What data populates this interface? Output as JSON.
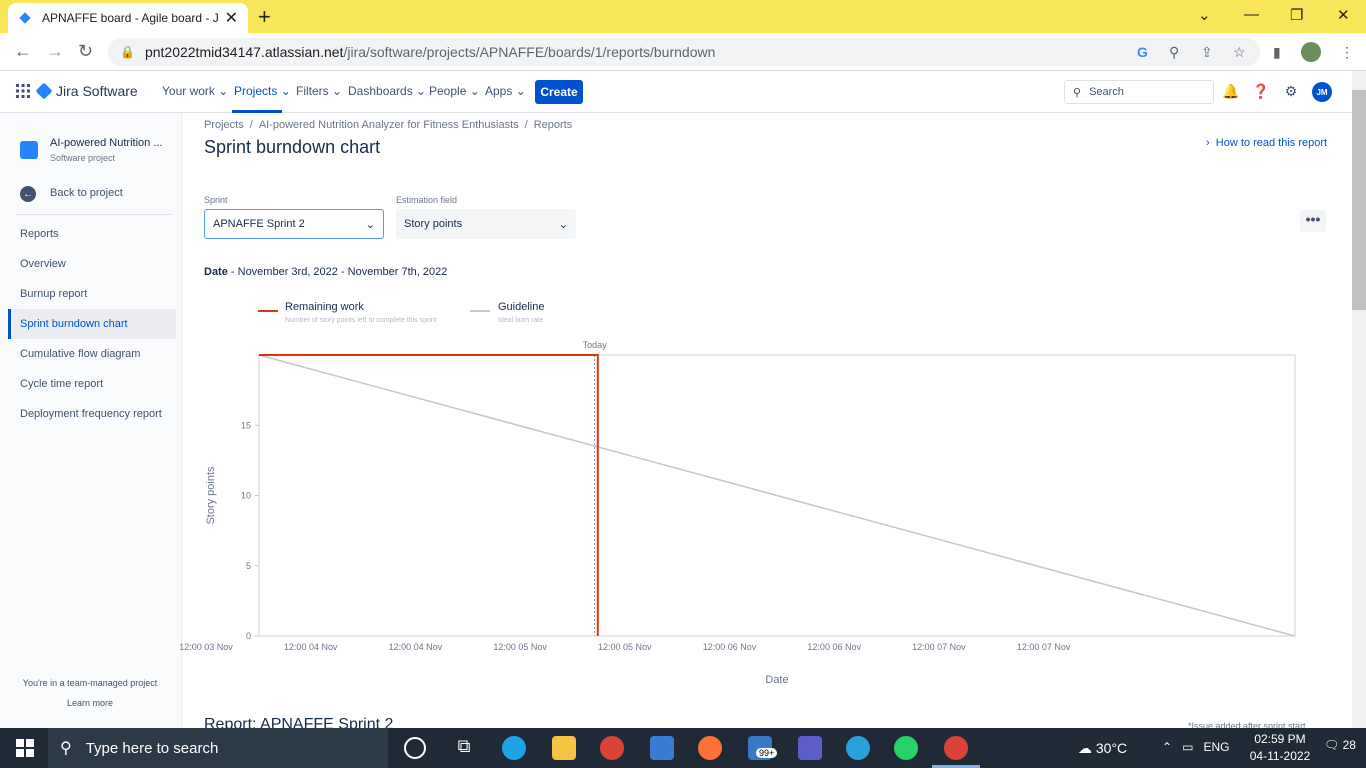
{
  "browser": {
    "tab_title": "APNAFFE board - Agile board - Ji",
    "url_domain": "pnt2022tmid34147.atlassian.net",
    "url_path": "/jira/software/projects/APNAFFE/boards/1/reports/burndown"
  },
  "nav": {
    "brand": "Jira Software",
    "items": [
      "Your work",
      "Projects",
      "Filters",
      "Dashboards",
      "People",
      "Apps"
    ],
    "create": "Create",
    "search_placeholder": "Search",
    "avatar": "JM"
  },
  "sidebar": {
    "project_name": "AI-powered Nutrition ...",
    "project_type": "Software project",
    "back": "Back to project",
    "heading": "Reports",
    "items": [
      "Overview",
      "Burnup report",
      "Sprint burndown chart",
      "Cumulative flow diagram",
      "Cycle time report",
      "Deployment frequency report"
    ],
    "selected": "Sprint burndown chart",
    "team_note": "You're in a team-managed project",
    "learn_more": "Learn more"
  },
  "main": {
    "breadcrumb": [
      "Projects",
      "AI-powered Nutrition Analyzer for Fitness Enthusiasts",
      "Reports"
    ],
    "title": "Sprint burndown chart",
    "how_to": "How to read this report",
    "sprint_label": "Sprint",
    "sprint_value": "APNAFFE Sprint 2",
    "estimation_label": "Estimation field",
    "estimation_value": "Story points",
    "date_label": "Date",
    "date_value": " - November 3rd, 2022 - November 7th, 2022",
    "next_heading": "Report: APNAFFE Sprint 2",
    "issue_note": "*Issue added after sprint start"
  },
  "legend": [
    {
      "name": "Remaining work",
      "desc": "Number of story points left to complete this sprint",
      "color": "#de350b"
    },
    {
      "name": "Guideline",
      "desc": "Ideal burn rate",
      "color": "#c1c7d0"
    }
  ],
  "chart_data": {
    "type": "line",
    "xlabel": "Date",
    "ylabel": "Story points",
    "today_label": "Today",
    "x_ticks": [
      "12:00 03 Nov",
      "12:00 04 Nov",
      "12:00 04 Nov",
      "12:00 05 Nov",
      "12:00 05 Nov",
      "12:00 06 Nov",
      "12:00 06 Nov",
      "12:00 07 Nov",
      "12:00 07 Nov"
    ],
    "y_ticks": [
      0,
      5,
      10,
      15
    ],
    "ylim": [
      0,
      20
    ],
    "series": [
      {
        "name": "Remaining work",
        "points": [
          [
            0,
            20
          ],
          [
            0.327,
            20
          ],
          [
            0.327,
            0
          ]
        ]
      },
      {
        "name": "Guideline",
        "points": [
          [
            0,
            20
          ],
          [
            1,
            0
          ]
        ]
      }
    ],
    "today_fraction": 0.324
  },
  "taskbar": {
    "search": "Type here to search",
    "weather": "30°C",
    "lang": "ENG",
    "time": "02:59 PM",
    "date": "04-11-2022",
    "notif_count": "28",
    "mail_badge": "99+"
  }
}
